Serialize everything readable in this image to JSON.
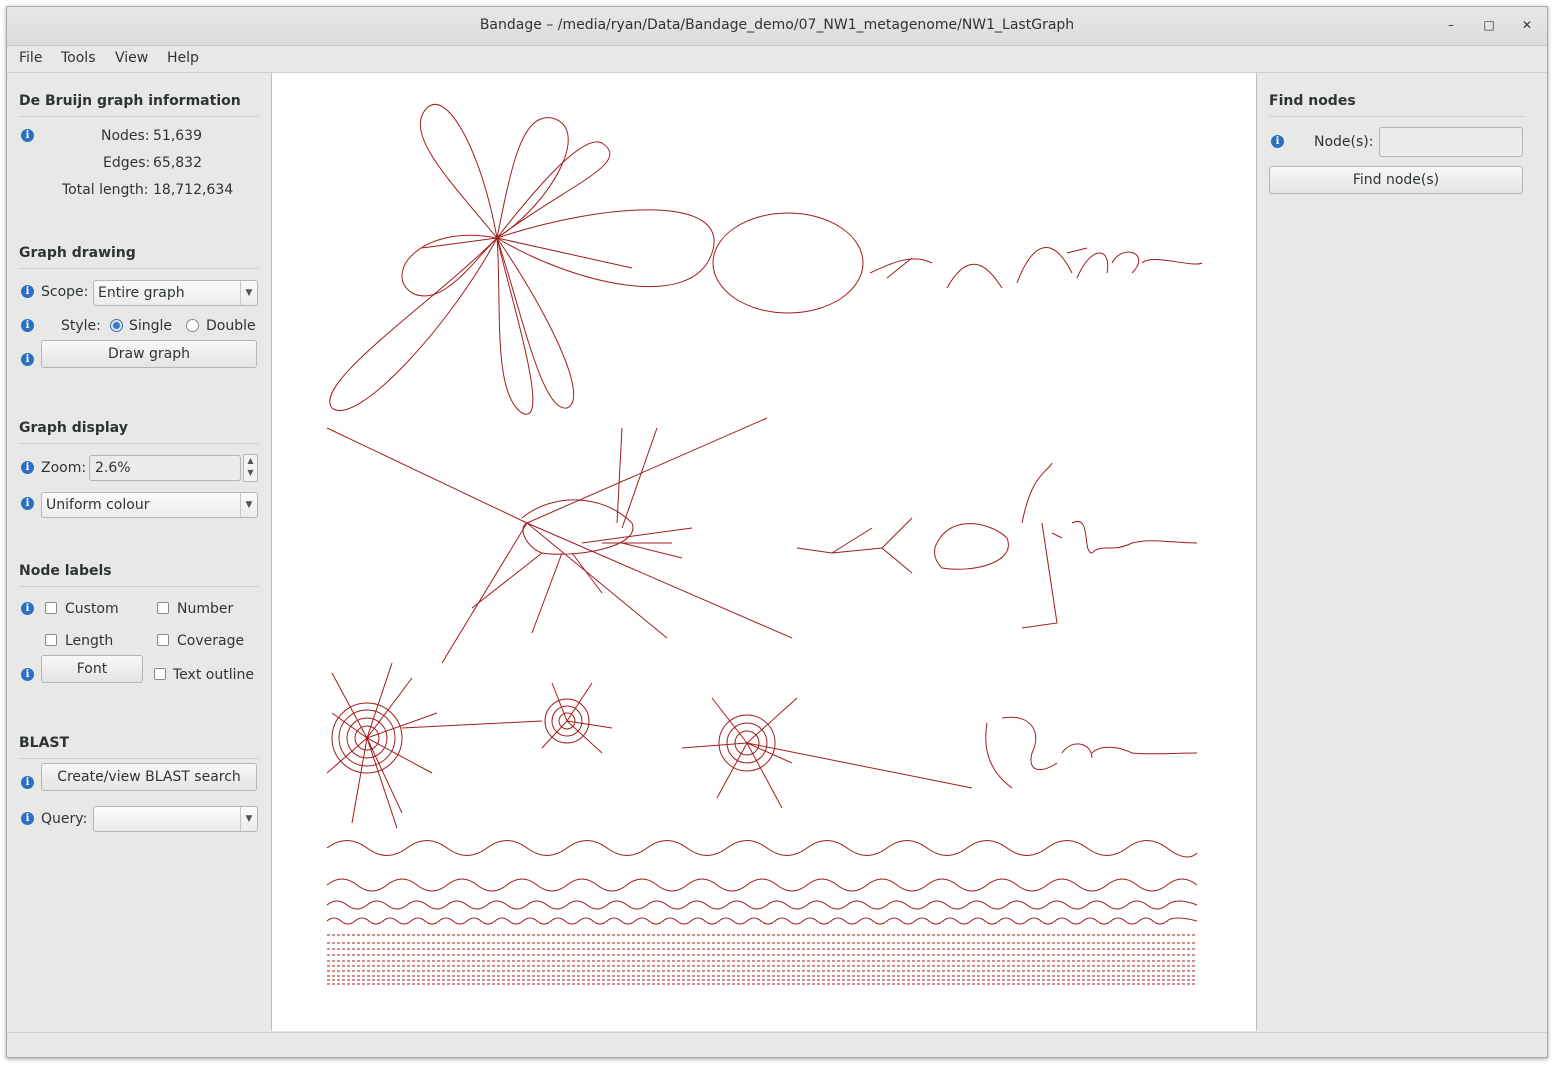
{
  "window": {
    "title": "Bandage – /media/ryan/Data/Bandage_demo/07_NW1_metagenome/NW1_LastGraph"
  },
  "menubar": {
    "items": [
      "File",
      "Tools",
      "View",
      "Help"
    ]
  },
  "graph_info": {
    "heading": "De Bruijn graph information",
    "nodes_label": "Nodes:",
    "nodes_value": "51,639",
    "edges_label": "Edges:",
    "edges_value": "65,832",
    "length_label": "Total length:",
    "length_value": "18,712,634"
  },
  "graph_drawing": {
    "heading": "Graph drawing",
    "scope_label": "Scope:",
    "scope_value": "Entire graph",
    "style_label": "Style:",
    "style_single": "Single",
    "style_double": "Double",
    "style_selected": "Single",
    "draw_button": "Draw graph"
  },
  "graph_display": {
    "heading": "Graph display",
    "zoom_label": "Zoom:",
    "zoom_value": "2.6%",
    "colour_value": "Uniform colour"
  },
  "node_labels": {
    "heading": "Node labels",
    "custom": "Custom",
    "number": "Number",
    "length": "Length",
    "coverage": "Coverage",
    "font_button": "Font",
    "text_outline": "Text outline"
  },
  "blast": {
    "heading": "BLAST",
    "search_button": "Create/view BLAST search",
    "query_label": "Query:",
    "query_value": ""
  },
  "find_nodes": {
    "heading": "Find nodes",
    "nodes_label": "Node(s):",
    "nodes_value": "",
    "find_button": "Find node(s)"
  },
  "colors": {
    "graph": "#a01c1c",
    "info_icon": "#2a6fc1"
  }
}
